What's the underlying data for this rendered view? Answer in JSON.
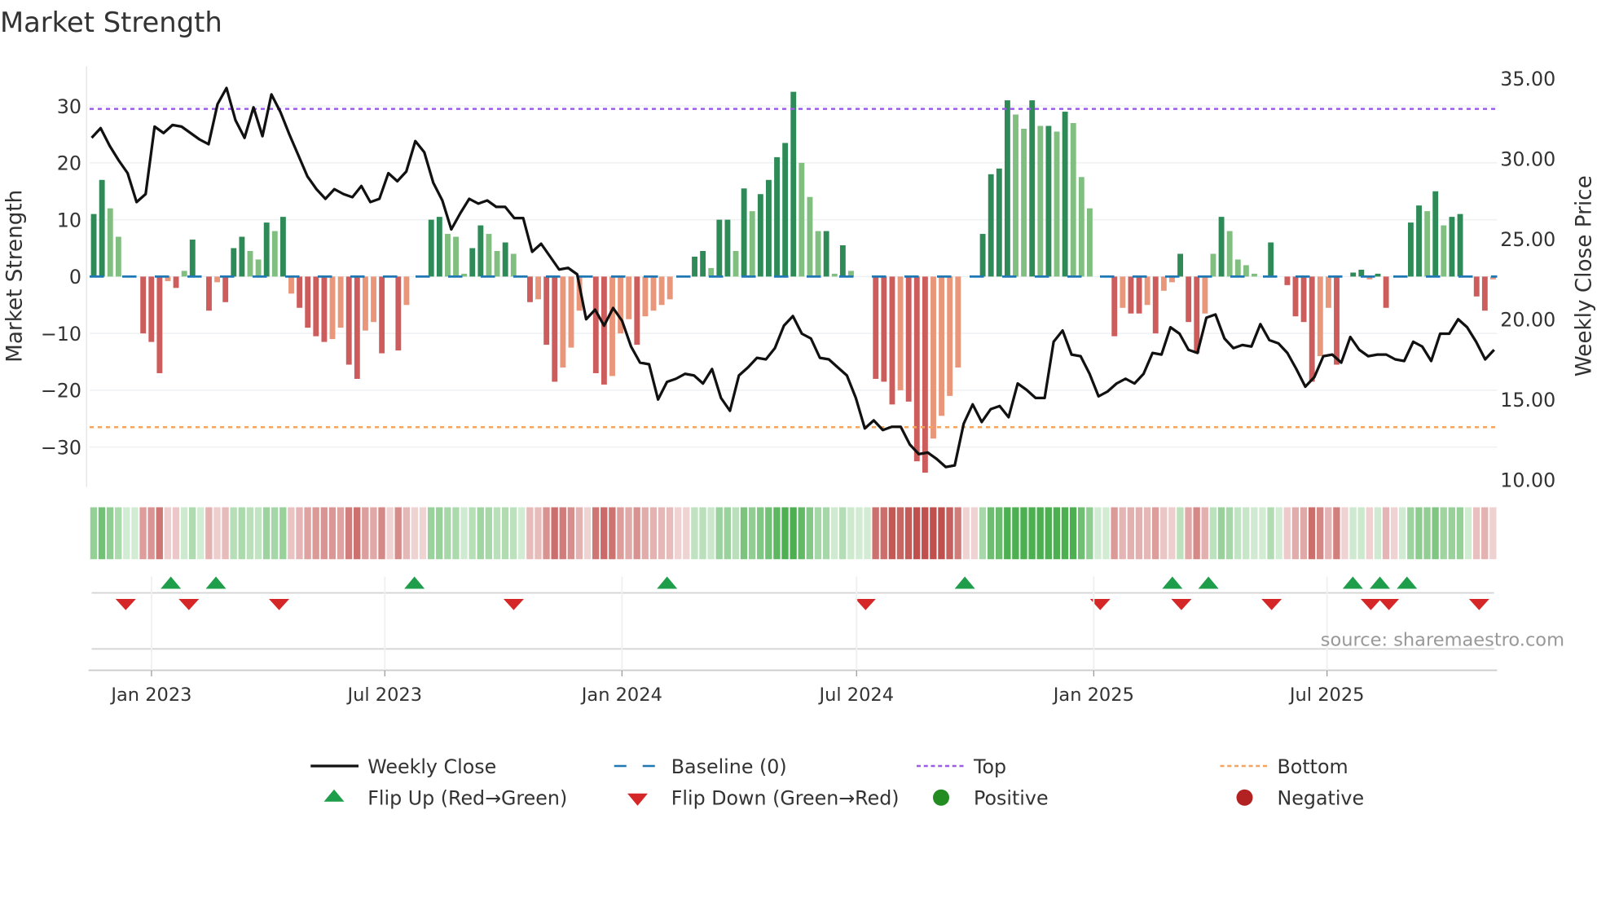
{
  "chart_data": {
    "type": "bar",
    "title": "Market Strength",
    "ylabel": "Market Strength",
    "y2label": "Weekly Close Price",
    "ylim": [
      -37,
      37
    ],
    "y2lim": [
      9.56,
      35.76
    ],
    "yticks": [
      30,
      20,
      10,
      0,
      -10,
      -20,
      -30
    ],
    "ytick_labels": [
      "30",
      "20",
      "10",
      "0",
      "−10",
      "−20",
      "−30"
    ],
    "y2ticks": [
      35,
      30,
      25,
      20,
      15,
      10
    ],
    "y2tick_labels": [
      "35.00",
      "30.00",
      "25.00",
      "20.00",
      "15.00",
      "10.00"
    ],
    "x_start": "2022-11-14",
    "x_weeks": 157,
    "xticks": [
      {
        "date": "2023-01-01",
        "label": "Jan 2023"
      },
      {
        "date": "2023-07-01",
        "label": "Jul 2023"
      },
      {
        "date": "2024-01-01",
        "label": "Jan 2024"
      },
      {
        "date": "2024-07-01",
        "label": "Jul 2024"
      },
      {
        "date": "2025-01-01",
        "label": "Jan 2025"
      },
      {
        "date": "2025-07-01",
        "label": "Jul 2025"
      }
    ],
    "top_level": 29.5,
    "bottom_level": -26.5,
    "baseline": 0,
    "strength": [
      11,
      17,
      12,
      7,
      0,
      0,
      -10,
      -11.5,
      -17,
      -0.8,
      -2,
      1,
      6.5,
      0,
      -6,
      -1,
      -4.5,
      5,
      7,
      4.5,
      3,
      9.5,
      8,
      10.5,
      -3,
      -5.5,
      -9,
      -10.5,
      -11.5,
      -11,
      -9,
      -15.5,
      -18,
      -9.5,
      -8,
      -13.5,
      0,
      -13,
      -5,
      0,
      0,
      10,
      10.5,
      7.5,
      7,
      0.5,
      5,
      9,
      7.5,
      4.5,
      6,
      4,
      0,
      -4.5,
      -4,
      -12,
      -18.5,
      -16,
      -12.5,
      -6,
      0,
      -17,
      -19,
      -17.5,
      -10,
      -7.5,
      -12,
      -7,
      -6,
      -5,
      -4,
      0,
      0,
      3.5,
      4.5,
      1.5,
      10,
      10,
      4.5,
      15.5,
      11.5,
      14.5,
      17,
      21,
      23.5,
      32.5,
      20,
      14,
      8,
      8,
      0.5,
      5.5,
      1,
      0,
      0,
      -18,
      -18.5,
      -22.5,
      -20,
      -22,
      -32.5,
      -34.5,
      -28.5,
      -24.5,
      -21,
      -16,
      0,
      0,
      7.5,
      18,
      19,
      31,
      28.5,
      26,
      31,
      26.5,
      26.5,
      25.5,
      29,
      27,
      17.5,
      12,
      0,
      0,
      -10.5,
      -5.5,
      -6.5,
      -6.5,
      -5,
      -10,
      -2.5,
      -1,
      4,
      -8,
      -13.5,
      -6.5,
      4,
      10.5,
      8,
      3,
      2,
      0.5,
      0,
      6,
      0,
      -1.5,
      -7,
      -8,
      -18.5,
      -14,
      -5.5,
      -15.5,
      0,
      0.7,
      1.2,
      -0.5,
      0.5,
      -5.5,
      0,
      0.2,
      9.5,
      12.5,
      11.5,
      15,
      9,
      10.5,
      11,
      0,
      -3.5,
      -6,
      -0.5
    ],
    "weekly_close": [
      31.3,
      31.9,
      30.8,
      29.9,
      29.1,
      27.3,
      27.8,
      32.0,
      31.6,
      32.1,
      32.0,
      31.6,
      31.2,
      30.9,
      33.4,
      34.4,
      32.4,
      31.3,
      33.2,
      31.4,
      34.0,
      32.9,
      31.5,
      30.2,
      28.9,
      28.1,
      27.5,
      28.1,
      27.8,
      27.6,
      28.3,
      27.3,
      27.5,
      29.1,
      28.6,
      29.2,
      31.1,
      30.4,
      28.5,
      27.4,
      25.6,
      26.6,
      27.5,
      27.2,
      27.4,
      27.0,
      27.0,
      26.3,
      26.3,
      24.2,
      24.7,
      23.9,
      23.1,
      23.2,
      22.8,
      20.0,
      20.6,
      19.6,
      20.7,
      19.9,
      18.3,
      17.3,
      17.2,
      15.0,
      16.1,
      16.3,
      16.6,
      16.5,
      16.0,
      16.9,
      15.1,
      14.3,
      16.5,
      17.0,
      17.6,
      17.5,
      18.2,
      19.6,
      20.2,
      19.1,
      18.8,
      17.6,
      17.5,
      17.0,
      16.5,
      15.1,
      13.2,
      13.7,
      13.1,
      13.3,
      13.3,
      12.2,
      11.6,
      11.7,
      11.3,
      10.8,
      10.9,
      13.5,
      14.7,
      13.6,
      14.4,
      14.6,
      13.9,
      16.0,
      15.6,
      15.1,
      15.1,
      18.6,
      19.3,
      17.8,
      17.7,
      16.6,
      15.2,
      15.5,
      16.0,
      16.3,
      16.0,
      16.6,
      17.9,
      17.8,
      19.5,
      19.1,
      18.1,
      17.9,
      20.1,
      20.3,
      18.8,
      18.2,
      18.4,
      18.3,
      19.7,
      18.7,
      18.5,
      17.9,
      16.9,
      15.8,
      16.4,
      17.7,
      17.8,
      17.3,
      18.9,
      18.1,
      17.7,
      17.8,
      17.8,
      17.5,
      17.4,
      18.6,
      18.3,
      17.4,
      19.1,
      19.1,
      20.0,
      19.5,
      18.6,
      17.5,
      18.1
    ],
    "flip_up": [
      "2023-01-16",
      "2023-02-20",
      "2023-07-24",
      "2024-02-05",
      "2024-09-23",
      "2025-03-03",
      "2025-03-31",
      "2025-07-21",
      "2025-08-11",
      "2025-09-01"
    ],
    "flip_down": [
      "2022-12-12",
      "2023-01-30",
      "2023-04-10",
      "2023-10-09",
      "2024-07-08",
      "2025-01-06",
      "2025-03-10",
      "2025-05-19",
      "2025-08-04",
      "2025-08-18",
      "2025-10-27"
    ],
    "legend": [
      {
        "key": "close",
        "label": "Weekly Close"
      },
      {
        "key": "baseline",
        "label": "Baseline (0)"
      },
      {
        "key": "top",
        "label": "Top"
      },
      {
        "key": "bottom",
        "label": "Bottom"
      },
      {
        "key": "flip_up",
        "label": "Flip Up (Red→Green)"
      },
      {
        "key": "flip_down",
        "label": "Flip Down (Green→Red)"
      },
      {
        "key": "positive",
        "label": "Positive"
      },
      {
        "key": "negative",
        "label": "Negative"
      }
    ],
    "legend_placement": "bottom",
    "source": "source: sharemaestro.com",
    "colors": {
      "pos_dark": "#2e8b57",
      "pos_light": "#80bf80",
      "neg_dark": "#cd5c5c",
      "neg_light": "#e9967a",
      "close": "#111111",
      "baseline": "#1f77b4",
      "top": "#9b5de5",
      "bottom": "#f4a460",
      "flip_up": "#1e9e4a",
      "flip_down": "#d62728",
      "positive": "#228b22",
      "negative": "#b22222"
    }
  }
}
